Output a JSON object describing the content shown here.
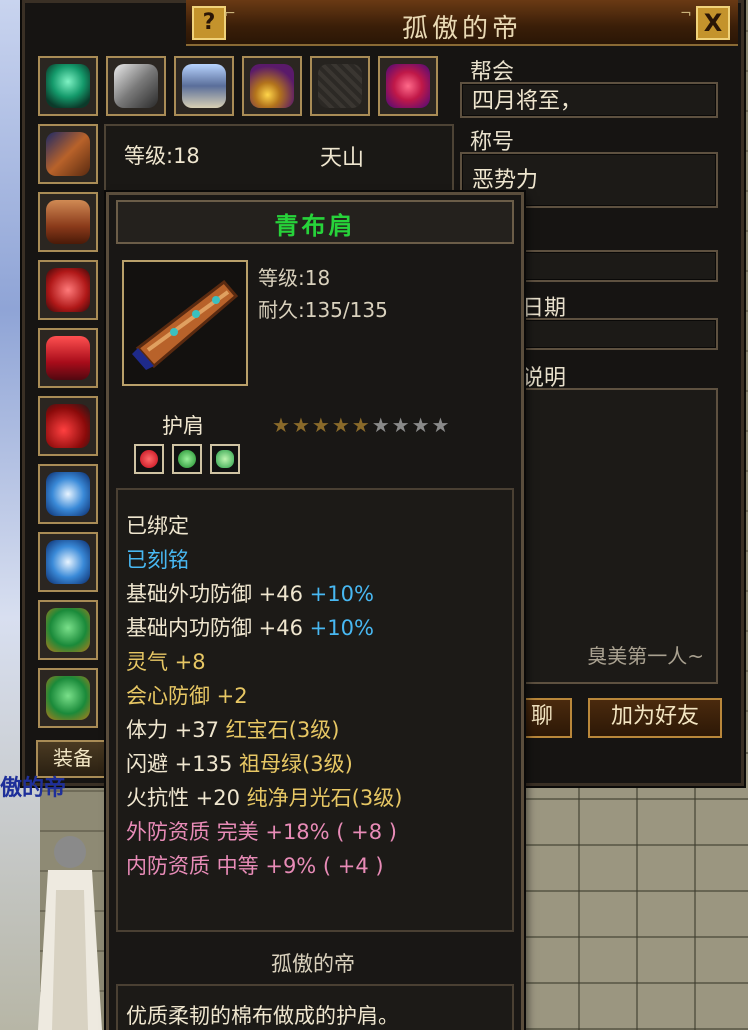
{
  "window": {
    "title": "孤傲的帝",
    "help_label": "?",
    "close_label": "X"
  },
  "equipment": {
    "tab_label": "装备",
    "top_slots": [
      "weapon-icon",
      "blade-icon",
      "armor-icon",
      "ring-icon",
      "empty-slot",
      "cloak-icon"
    ],
    "side_slots": [
      "shoulder-icon",
      "bracer-icon",
      "glove-icon",
      "belt-icon",
      "boot-icon",
      "jade-icon",
      "jade-icon",
      "pouch-icon",
      "pouch-icon"
    ]
  },
  "stats": {
    "level": "等级:18",
    "sect": "天山"
  },
  "info": {
    "guild_label": "帮会",
    "guild_value": "四月将至，",
    "title_label": "称号",
    "title_value": "恶势力",
    "date_label": "日期",
    "desc_label": "说明",
    "signature": "臭美第一人~",
    "chat_button": "聊",
    "add_friend_button": "加为好友"
  },
  "tooltip": {
    "item_name": "青布肩",
    "level": "等级:18",
    "durability": "耐久:135/135",
    "item_type": "护肩",
    "stars_filled": 5,
    "stars_total": 9,
    "gems": [
      "red",
      "green",
      "green"
    ],
    "attributes": [
      {
        "text": "已绑定",
        "color": "white"
      },
      {
        "text": "已刻铭",
        "color": "blue"
      },
      {
        "text": "基础外功防御 +46",
        "extra": " +10%",
        "color": "white",
        "extra_color": "blue"
      },
      {
        "text": "基础内功防御 +46",
        "extra": " +10%",
        "color": "white",
        "extra_color": "blue"
      },
      {
        "text": "灵气 +8",
        "color": "yellow"
      },
      {
        "text": "会心防御 +2",
        "color": "yellow"
      },
      {
        "text": "体力 +37",
        "extra": "  红宝石(3级)",
        "color": "white",
        "extra_color": "yellow"
      },
      {
        "text": "闪避 +135",
        "extra": "  祖母绿(3级)",
        "color": "white",
        "extra_color": "yellow"
      },
      {
        "text": "火抗性 +20",
        "extra": "  纯净月光石(3级)",
        "color": "white",
        "extra_color": "yellow"
      },
      {
        "text": "外防资质  完美  +18%  ( +8 )",
        "color": "pink"
      },
      {
        "text": "内防资质  中等  +9%  ( +4 )",
        "color": "pink"
      }
    ],
    "maker": "孤傲的帝",
    "description": "优质柔韧的棉布做成的护肩。"
  },
  "colors": {
    "green_name": "#27d33a",
    "blue": "#48b8f2",
    "yellow": "#e7c764",
    "pink": "#e88bb7",
    "panel_bg": "#161412",
    "frame_gold": "#a98c56"
  },
  "world": {
    "floater_text": "傲的帝"
  }
}
